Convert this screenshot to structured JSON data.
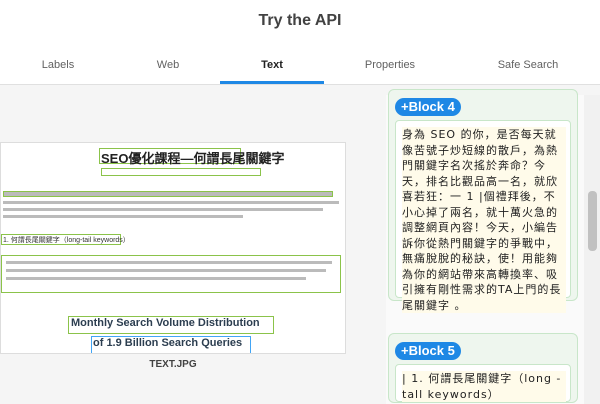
{
  "page": {
    "title": "Try the API"
  },
  "tabs": [
    {
      "label": "Labels"
    },
    {
      "label": "Web"
    },
    {
      "label": "Text",
      "active": true
    },
    {
      "label": "Properties"
    },
    {
      "label": "Safe Search"
    }
  ],
  "preview": {
    "heading": "SEO優化課程—何謂長尾關鍵字",
    "section": "1. 何謂長尾關鍵字（long-tail keywords）",
    "chart_title_line1": "Monthly Search Volume Distribution",
    "chart_title_line2": "of 1.9 Billion Search Queries",
    "caption": "TEXT.JPG"
  },
  "blocks": [
    {
      "label": "+Block 4",
      "text": "身為 SEO 的你，是否每天就像苦號子炒短線的散戶，為熱門關鍵字名次搖於奔命？今天，排名比觀品高一名，就欣喜若狂：一 1 |個禮拜後，不小心掉了兩名，就十萬火急的調整網頁內容！今天，小編告訴你從熱門關鍵字的爭戰中，無痛脫脫的秘訣，使！用能夠為你的網站帶來高轉換率、吸引擁有剛性需求的TA上門的長尾關鍵字 。"
    },
    {
      "label": "+Block 5",
      "text": "| 1. 何謂長尾關鍵字（long - tall keywords）"
    }
  ],
  "colors": {
    "accent": "#1e88e5",
    "box_green": "#8bc34a",
    "card_bg": "#eef6ee"
  }
}
